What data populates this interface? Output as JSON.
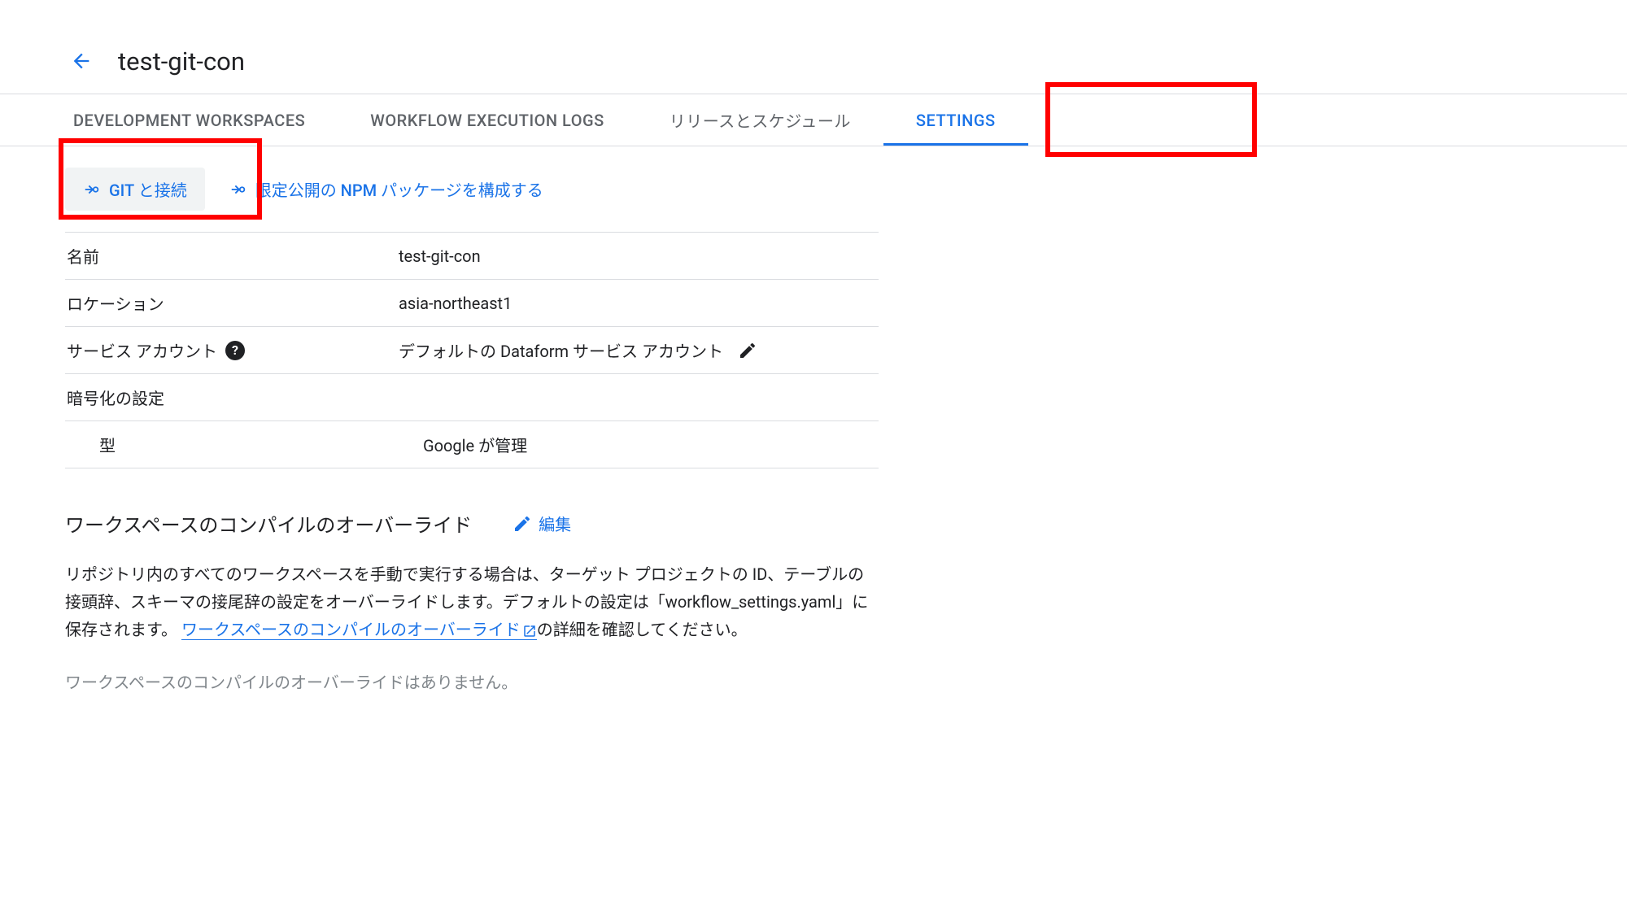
{
  "header": {
    "title": "test-git-con"
  },
  "tabs": {
    "dev": "DEVELOPMENT WORKSPACES",
    "logs": "WORKFLOW EXECUTION LOGS",
    "release": "リリースとスケジュール",
    "settings": "SETTINGS"
  },
  "actions": {
    "git_connect": "GIT と接続",
    "npm_config": "限定公開の NPM パッケージを構成する"
  },
  "settings_rows": {
    "name_label": "名前",
    "name_value": "test-git-con",
    "location_label": "ロケーション",
    "location_value": "asia-northeast1",
    "service_account_label": "サービス アカウント",
    "service_account_value": "デフォルトの Dataform サービス アカウント",
    "encryption_label": "暗号化の設定",
    "type_label": "型",
    "type_value": "Google が管理"
  },
  "override_section": {
    "title": "ワークスペースのコンパイルのオーバーライド",
    "edit_label": "編集",
    "desc_1": "リポジトリ内のすべてのワークスペースを手動で実行する場合は、ターゲット プロジェクトの ID、テーブルの接頭辞、スキーマの接尾辞の設定をオーバーライドします。デフォルトの設定は「workflow_settings.yaml」に保存されます。",
    "desc_link": "ワークスペースのコンパイルのオーバーライド",
    "desc_2": "の詳細を確認してください。",
    "note": "ワークスペースのコンパイルのオーバーライドはありません。"
  }
}
